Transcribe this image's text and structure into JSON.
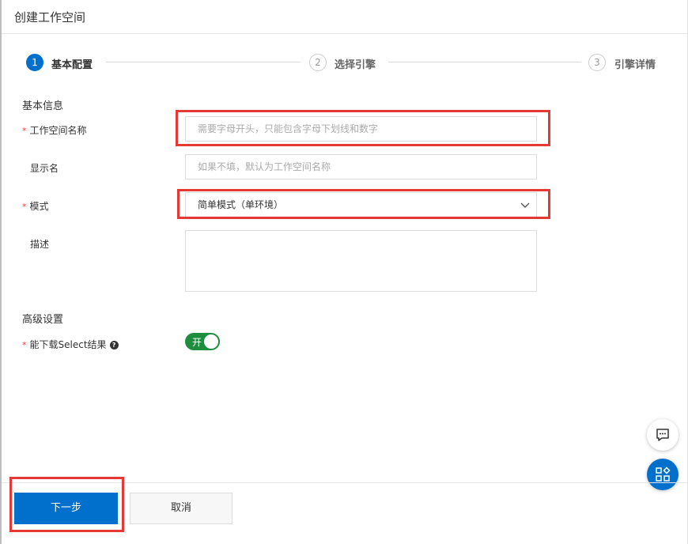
{
  "dialog": {
    "title": "创建工作空间"
  },
  "steps": [
    {
      "number": "1",
      "label": "基本配置",
      "state": "active"
    },
    {
      "number": "2",
      "label": "选择引擎",
      "state": "inactive"
    },
    {
      "number": "3",
      "label": "引擎详情",
      "state": "inactive"
    }
  ],
  "basic": {
    "section_title": "基本信息",
    "workspace_name": {
      "required_mark": "*",
      "label": "工作空间名称",
      "placeholder": "需要字母开头，只能包含字母下划线和数字",
      "value": ""
    },
    "display_name": {
      "label": "显示名",
      "placeholder": "如果不填，默认为工作空间名称",
      "value": ""
    },
    "mode": {
      "required_mark": "*",
      "label": "模式",
      "selected": "简单模式（单环境）"
    },
    "description": {
      "label": "描述",
      "value": ""
    }
  },
  "advanced": {
    "section_title": "高级设置",
    "download_select": {
      "required_mark": "*",
      "label": "能下载Select结果",
      "help": "?",
      "toggle_text": "开",
      "enabled": true
    }
  },
  "footer": {
    "next_label": "下一步",
    "cancel_label": "取消"
  },
  "colors": {
    "primary": "#0070cc",
    "toggle_on": "#1e8e3e",
    "highlight": "#e53935",
    "required": "#e54545"
  }
}
